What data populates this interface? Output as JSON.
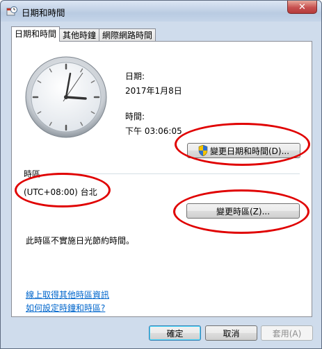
{
  "window": {
    "title": "日期和時間",
    "close_glyph": "✕"
  },
  "tabs": [
    {
      "label": "日期和時間",
      "active": true
    },
    {
      "label": "其他時鐘",
      "active": false
    },
    {
      "label": "網際網路時間",
      "active": false
    }
  ],
  "datetime": {
    "date_label": "日期:",
    "date_value": "2017年1月8日",
    "time_label": "時間:",
    "time_value": "下午 03:06:05",
    "change_button": "變更日期和時間(D)..."
  },
  "timezone": {
    "section_label": "時區",
    "value": "(UTC+08:00) 台北",
    "change_button": "變更時區(Z)...",
    "dst_note": "此時區不實施日光節約時間。"
  },
  "links": {
    "more_info": "線上取得其他時區資訊",
    "how_to": "如何設定時鐘和時區?"
  },
  "footer": {
    "ok": "確定",
    "cancel": "取消",
    "apply": "套用(A)"
  },
  "icons": {
    "title": "clock-window-icon",
    "shield": "uac-shield-icon"
  },
  "colors": {
    "annotation": "#e00000",
    "link": "#0066cc"
  }
}
